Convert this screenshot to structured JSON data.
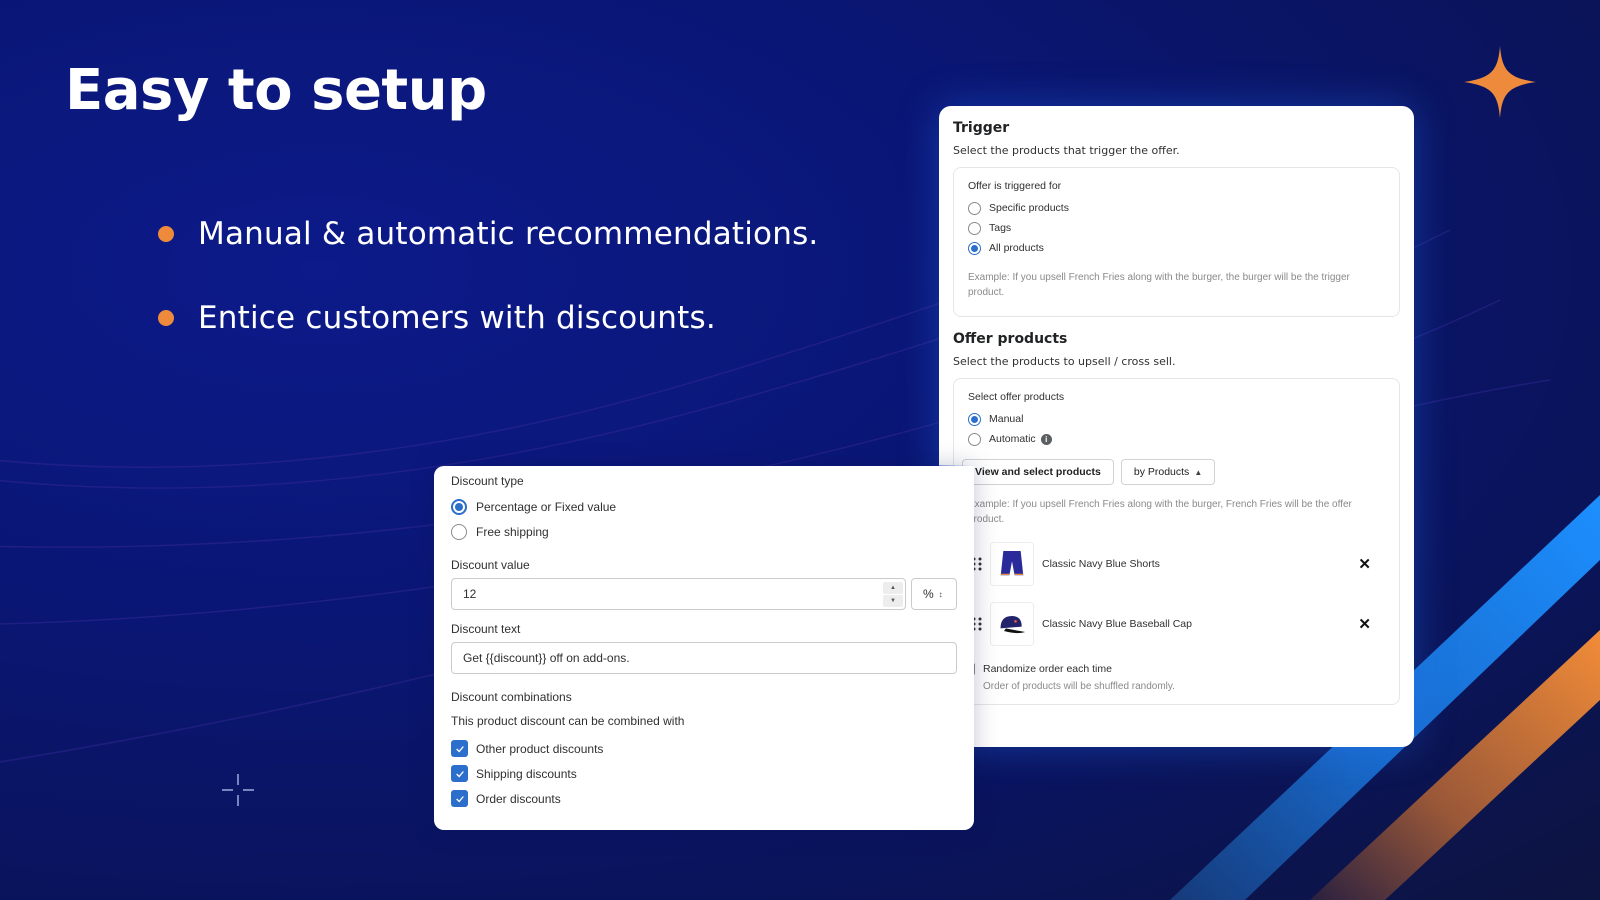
{
  "headline": "Easy to setup",
  "bullets": [
    "Manual & automatic recommendations.",
    "Entice customers with discounts."
  ],
  "colors": {
    "accent_orange": "#ee8a3c",
    "accent_blue": "#2c6ecb",
    "background_navy": "#0a1674"
  },
  "trigger": {
    "title": "Trigger",
    "subtitle": "Select the products that trigger the offer.",
    "group_label": "Offer is triggered for",
    "options": [
      {
        "label": "Specific products",
        "selected": false
      },
      {
        "label": "Tags",
        "selected": false
      },
      {
        "label": "All products",
        "selected": true
      }
    ],
    "help": "Example: If you upsell French Fries along with the burger, the burger will be the trigger product."
  },
  "offer": {
    "title": "Offer products",
    "subtitle": "Select the products to upsell / cross sell.",
    "group_label": "Select offer products",
    "options": [
      {
        "label": "Manual",
        "selected": true
      },
      {
        "label": "Automatic",
        "selected": false
      }
    ],
    "info_icon": "info-icon",
    "view_button": "View and select products",
    "sort_select": "by Products",
    "help": "Example: If you upsell French Fries along with the burger, French Fries will be the offer product.",
    "products": [
      {
        "name": "Classic Navy Blue Shorts",
        "icon": "shorts-icon"
      },
      {
        "name": "Classic Navy Blue Baseball Cap",
        "icon": "cap-icon"
      }
    ],
    "randomize_label": "Randomize order each time",
    "randomize_checked": false,
    "randomize_help": "Order of products will be shuffled randomly."
  },
  "discount": {
    "type_label": "Discount type",
    "type_options": [
      {
        "label": "Percentage or Fixed value",
        "selected": true
      },
      {
        "label": "Free shipping",
        "selected": false
      }
    ],
    "value_label": "Discount value",
    "value": "12",
    "unit": "%",
    "text_label": "Discount text",
    "text_value": "Get {{discount}} off on add-ons.",
    "combinations_label": "Discount combinations",
    "combinations_sub": "This product discount can be combined with",
    "combinations": [
      {
        "label": "Other product discounts",
        "checked": true
      },
      {
        "label": "Shipping discounts",
        "checked": true
      },
      {
        "label": "Order discounts",
        "checked": true
      }
    ]
  }
}
